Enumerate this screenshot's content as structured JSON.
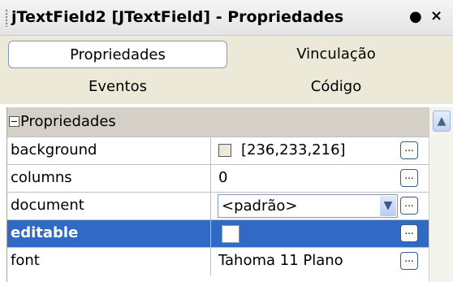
{
  "window": {
    "title": "jTextField2 [JTextField] - Propriedades",
    "pin_icon": "pin-icon",
    "close_icon": "close-icon"
  },
  "tabs": [
    {
      "label": "Propriedades",
      "selected": true
    },
    {
      "label": "Vinculação",
      "selected": false
    },
    {
      "label": "Eventos",
      "selected": false
    },
    {
      "label": "Código",
      "selected": false
    }
  ],
  "category": {
    "label": "Propriedades",
    "expanded": true
  },
  "properties": [
    {
      "name": "background",
      "value": "[236,233,216]",
      "swatch_color": "#ece9d8"
    },
    {
      "name": "columns",
      "value": "0"
    },
    {
      "name": "document",
      "value": "<padrão>"
    },
    {
      "name": "editable",
      "value": "",
      "checked": false,
      "selected": true
    },
    {
      "name": "font",
      "value": "Tahoma 11 Plano"
    }
  ],
  "ellipsis_label": "...",
  "colors": {
    "selection": "#316ac5",
    "panel": "#ece9d8",
    "category_bg": "#d4d0c8"
  }
}
